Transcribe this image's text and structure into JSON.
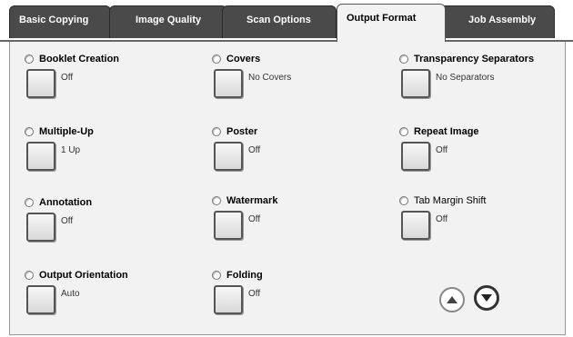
{
  "tabs": [
    {
      "label": "Basic Copying",
      "active": false
    },
    {
      "label": "Image Quality",
      "active": false
    },
    {
      "label": "Scan Options",
      "active": false
    },
    {
      "label": "Output Format",
      "active": true
    },
    {
      "label": "Job Assembly",
      "active": false
    }
  ],
  "features": [
    {
      "title": "Booklet Creation",
      "value": "Off"
    },
    {
      "title": "Covers",
      "value": "No Covers"
    },
    {
      "title": "Transparency Separators",
      "value": "No Separators"
    },
    {
      "title": "Multiple-Up",
      "value": "1 Up"
    },
    {
      "title": "Poster",
      "value": "Off"
    },
    {
      "title": "Repeat Image",
      "value": "Off"
    },
    {
      "title": "Annotation",
      "value": "Off"
    },
    {
      "title": "Watermark",
      "value": "Off"
    },
    {
      "title": "Tab Margin Shift",
      "value": "Off"
    },
    {
      "title": "Output Orientation",
      "value": "Auto"
    },
    {
      "title": "Folding",
      "value": "Off"
    }
  ],
  "scroll": {
    "up_icon": "triangle-up-icon",
    "down_icon": "triangle-down-icon"
  }
}
